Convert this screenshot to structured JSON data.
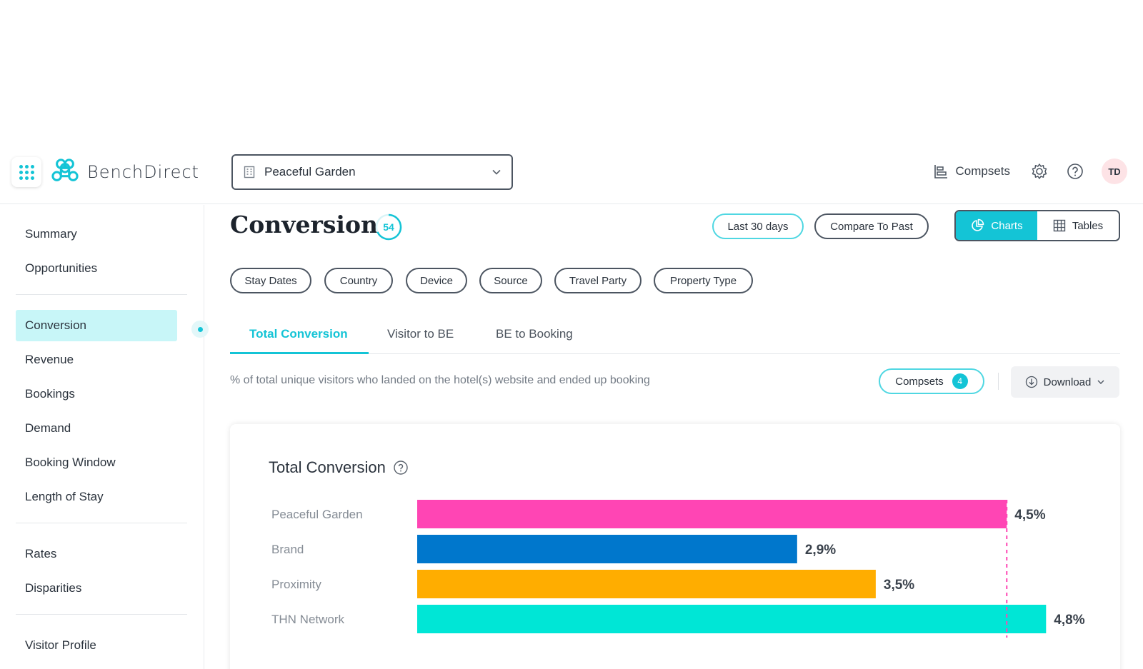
{
  "header": {
    "brand": "BenchDirect",
    "property": "Peaceful Garden",
    "compsets_label": "Compsets",
    "avatar_initials": "TD"
  },
  "sidebar": {
    "groups": [
      [
        "Summary",
        "Opportunities"
      ],
      [
        "Conversion",
        "Revenue",
        "Bookings",
        "Demand",
        "Booking Window",
        "Length of Stay"
      ],
      [
        "Rates",
        "Disparities"
      ],
      [
        "Visitor Profile"
      ]
    ],
    "active": "Conversion"
  },
  "page": {
    "title": "Conversion",
    "score": "54",
    "date_range": "Last 30 days",
    "compare": "Compare To Past",
    "view_charts": "Charts",
    "view_tables": "Tables",
    "filters": [
      "Stay Dates",
      "Country",
      "Device",
      "Source",
      "Travel Party",
      "Property Type"
    ],
    "tabs": [
      "Total Conversion",
      "Visitor to BE",
      "BE to Booking"
    ],
    "active_tab": "Total Conversion",
    "description": "% of total unique visitors who landed on the hotel(s) website and ended up booking",
    "compsets_label": "Compsets",
    "compsets_count": "4",
    "download_label": "Download"
  },
  "chart_data": {
    "type": "bar",
    "orientation": "horizontal",
    "title": "Total Conversion",
    "categories": [
      "Peaceful Garden",
      "Brand",
      "Proximity",
      "THN Network"
    ],
    "values": [
      4.5,
      2.9,
      3.5,
      4.8
    ],
    "labels": [
      "4,5%",
      "2,9%",
      "3,5%",
      "4,8%"
    ],
    "colors": [
      "#ff45b4",
      "#0077cc",
      "#ffad00",
      "#00e6d6"
    ],
    "reference_line": 4.5,
    "reference_color": "#ff45b4",
    "xlim": [
      0,
      5.3
    ],
    "grid": false
  },
  "colors": {
    "accent": "#14c4d6",
    "active_nav_bg": "#c8f6f8"
  }
}
